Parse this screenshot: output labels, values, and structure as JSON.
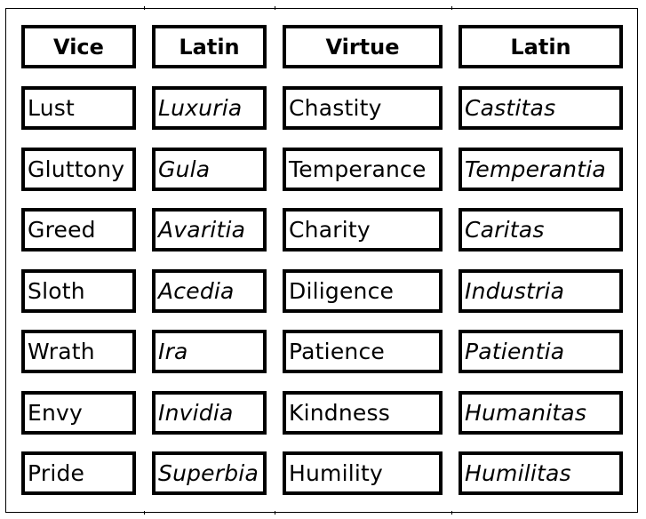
{
  "headers": [
    "Vice",
    "Latin",
    "Virtue",
    "Latin"
  ],
  "rows": [
    {
      "vice": "Lust",
      "vice_latin": "Luxuria",
      "virtue": "Chastity",
      "virtue_latin": "Castitas"
    },
    {
      "vice": "Gluttony",
      "vice_latin": "Gula",
      "virtue": "Temperance",
      "virtue_latin": "Temperantia"
    },
    {
      "vice": "Greed",
      "vice_latin": "Avaritia",
      "virtue": "Charity",
      "virtue_latin": "Caritas"
    },
    {
      "vice": "Sloth",
      "vice_latin": "Acedia",
      "virtue": "Diligence",
      "virtue_latin": "Industria"
    },
    {
      "vice": "Wrath",
      "vice_latin": "Ira",
      "virtue": "Patience",
      "virtue_latin": "Patientia"
    },
    {
      "vice": "Envy",
      "vice_latin": "Invidia",
      "virtue": "Kindness",
      "virtue_latin": "Humanitas"
    },
    {
      "vice": "Pride",
      "vice_latin": "Superbia",
      "virtue": "Humility",
      "virtue_latin": "Humilitas"
    }
  ]
}
